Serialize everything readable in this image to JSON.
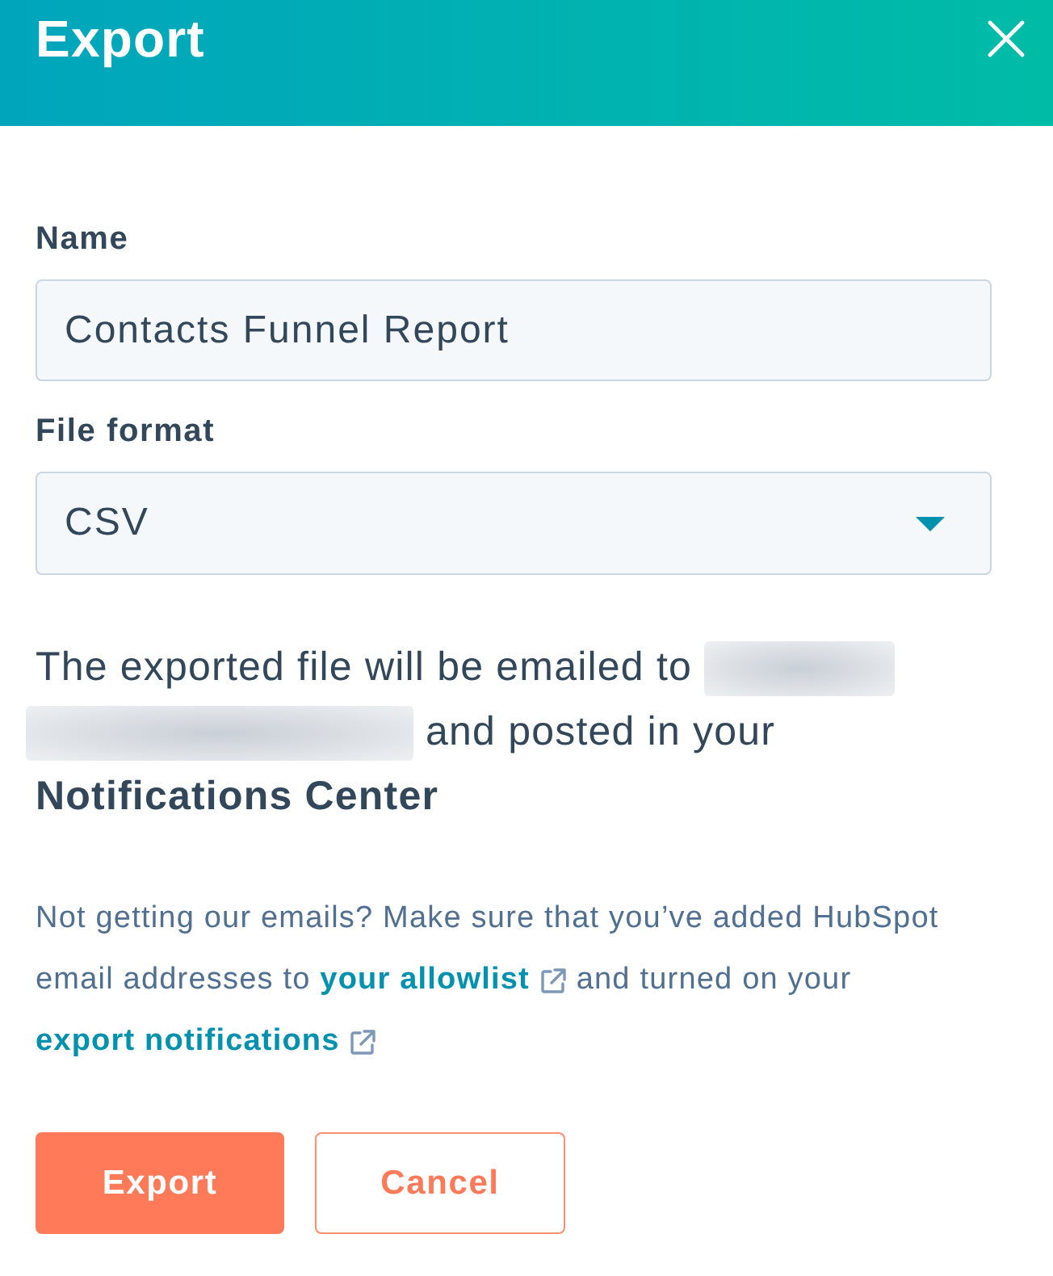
{
  "dialog": {
    "title": "Export"
  },
  "fields": [
    {
      "kind": "text",
      "label": "Name",
      "value": "Contacts Funnel Report"
    },
    {
      "kind": "select",
      "label": "File format",
      "value": "CSV"
    }
  ],
  "notice": [
    {
      "kind": "text",
      "text": "The exported file will be emailed to"
    },
    {
      "kind": "redacted"
    },
    {
      "kind": "redacted"
    },
    {
      "kind": "text",
      "text": "and posted in your"
    },
    {
      "kind": "bold",
      "text": "Notifications Center"
    }
  ],
  "help": [
    {
      "kind": "text",
      "text": "Not getting our emails? Make sure that you’ve added HubSpot email addresses to "
    },
    {
      "kind": "link",
      "text": "your allowlist"
    },
    {
      "kind": "text",
      "text": " and turned on your "
    },
    {
      "kind": "link",
      "text": "export notifications"
    }
  ],
  "buttons": [
    {
      "kind": "primary",
      "label": "Export"
    },
    {
      "kind": "secondary",
      "label": "Cancel"
    }
  ]
}
